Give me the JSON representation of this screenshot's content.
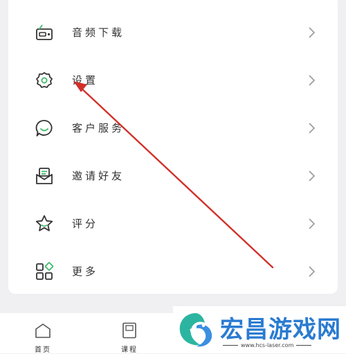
{
  "menu": {
    "items": [
      {
        "label": "音频下载",
        "icon": "radio-icon"
      },
      {
        "label": "设置",
        "icon": "gear-icon"
      },
      {
        "label": "客户服务",
        "icon": "chat-smile-icon"
      },
      {
        "label": "邀请好友",
        "icon": "envelope-icon"
      },
      {
        "label": "评分",
        "icon": "star-icon"
      },
      {
        "label": "更多",
        "icon": "grid-icon"
      }
    ]
  },
  "tabbar": {
    "tabs": [
      {
        "label": "首页",
        "icon": "home-icon"
      },
      {
        "label": "课程",
        "icon": "book-icon"
      }
    ]
  },
  "watermark": {
    "title": "宏昌游戏网",
    "url": "www.hcs-laser.com"
  },
  "colors": {
    "icon_stroke": "#333333",
    "icon_accent": "#3dba6a",
    "annotation_arrow": "#d1302a",
    "watermark_blue": "#2a7bd1"
  }
}
